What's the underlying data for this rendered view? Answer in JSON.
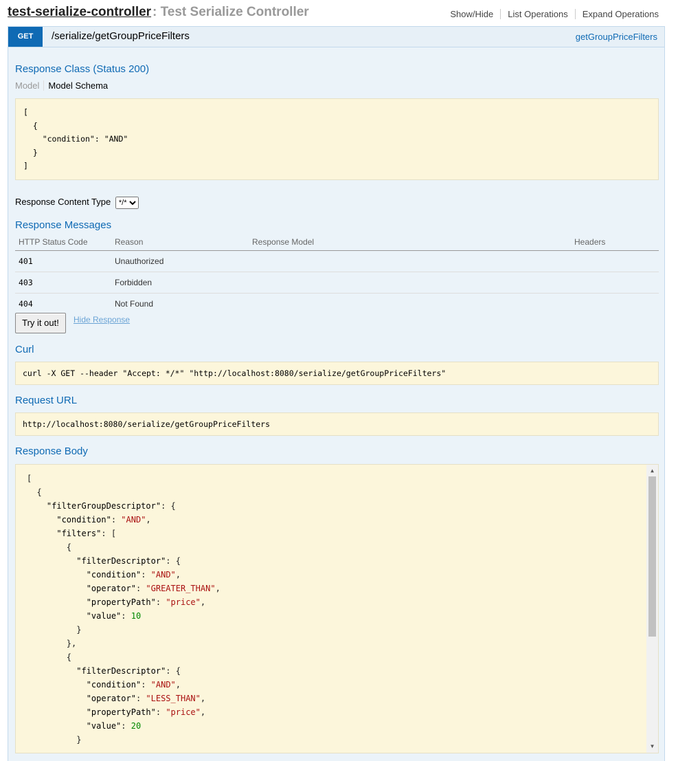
{
  "header": {
    "controller": "test-serialize-controller",
    "separator": " : Test Serialize Controller",
    "ops": [
      "Show/Hide",
      "List Operations",
      "Expand Operations"
    ]
  },
  "operation": {
    "method": "GET",
    "path": "/serialize/getGroupPriceFilters",
    "nickname": "getGroupPriceFilters"
  },
  "response_class": {
    "title": "Response Class (Status 200)",
    "tab_model": "Model",
    "tab_schema": "Model Schema",
    "schema": "[\n  {\n    \"condition\": \"AND\"\n  }\n]"
  },
  "content_type": {
    "label": "Response Content Type",
    "selected": "*/*"
  },
  "messages": {
    "title": "Response Messages",
    "columns": [
      "HTTP Status Code",
      "Reason",
      "Response Model",
      "Headers"
    ],
    "rows": [
      {
        "code": "401",
        "reason": "Unauthorized"
      },
      {
        "code": "403",
        "reason": "Forbidden"
      },
      {
        "code": "404",
        "reason": "Not Found"
      }
    ]
  },
  "actions": {
    "try_label": "Try it out!",
    "hide_label": "Hide Response"
  },
  "curl": {
    "title": "Curl",
    "command": "curl -X GET --header \"Accept: */*\" \"http://localhost:8080/serialize/getGroupPriceFilters\""
  },
  "request_url": {
    "title": "Request URL",
    "url": "http://localhost:8080/serialize/getGroupPriceFilters"
  },
  "response_body": {
    "title": "Response Body",
    "lines": [
      "[",
      "  {",
      "    \"filterGroupDescriptor\": {",
      "      \"condition\": \"AND\",",
      "      \"filters\": [",
      "        {",
      "          \"filterDescriptor\": {",
      "            \"condition\": \"AND\",",
      "            \"operator\": \"GREATER_THAN\",",
      "            \"propertyPath\": \"price\",",
      "            \"value\": 10",
      "          }",
      "        },",
      "        {",
      "          \"filterDescriptor\": {",
      "            \"condition\": \"AND\",",
      "            \"operator\": \"LESS_THAN\",",
      "            \"propertyPath\": \"price\",",
      "            \"value\": 20",
      "          }"
    ]
  }
}
